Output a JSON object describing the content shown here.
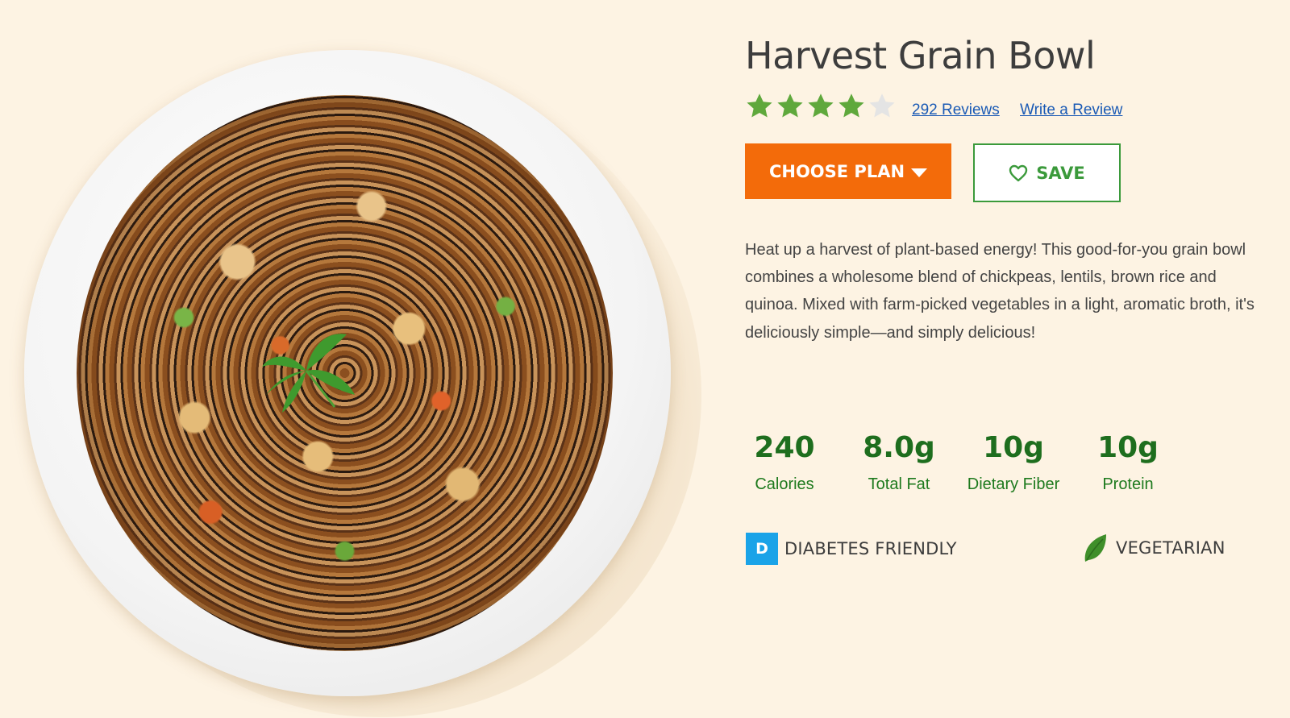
{
  "product": {
    "title": "Harvest Grain Bowl",
    "rating": {
      "stars_filled": 4,
      "stars_total": 5,
      "reviews_label": "292 Reviews",
      "write_review_label": "Write a Review"
    },
    "actions": {
      "choose_plan_label": "CHOOSE PLAN",
      "save_label": "SAVE"
    },
    "description": "Heat up a harvest of plant-based energy! This good-for-you grain bowl combines a wholesome blend of chickpeas, lentils, brown rice and quinoa. Mixed with farm-picked vegetables in a light, aromatic broth, it's deliciously simple—and simply delicious!",
    "nutrition": [
      {
        "value": "240",
        "label": "Calories"
      },
      {
        "value": "8.0g",
        "label": "Total Fat"
      },
      {
        "value": "10g",
        "label": "Dietary Fiber"
      },
      {
        "value": "10g",
        "label": "Protein"
      }
    ],
    "badges": {
      "diabetes": {
        "icon_letter": "D",
        "label": "DIABETES FRIENDLY",
        "icon": "d-badge-icon"
      },
      "vegetarian": {
        "label": "VEGETARIAN",
        "icon": "leaf-icon"
      }
    }
  },
  "colors": {
    "background": "#fdf3e3",
    "accent_orange": "#f36b0a",
    "accent_green": "#3b9a3b",
    "nutrition_green": "#1e6e1e",
    "star_filled": "#5fa83c",
    "star_empty": "#e4e4e4",
    "link_blue": "#1a5ab5",
    "diabetes_blue": "#1aa3e8"
  }
}
